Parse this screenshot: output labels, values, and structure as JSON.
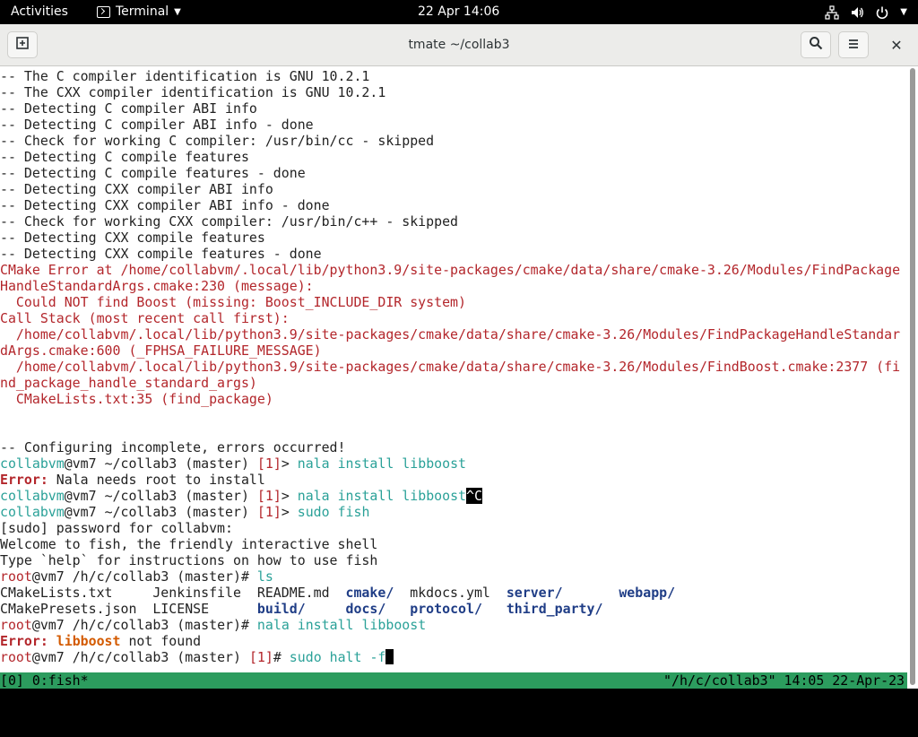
{
  "topbar": {
    "activities": "Activities",
    "app_name": "Terminal",
    "clock": "22 Apr  14:06",
    "tray_icons": [
      "network-icon",
      "volume-icon",
      "power-icon",
      "menu-caret-icon"
    ]
  },
  "window": {
    "title": "tmate ~/collab3",
    "buttons": {
      "new_tab": "new-tab-icon",
      "search": "search-icon",
      "menu": "hamburger-icon",
      "close": "✕"
    }
  },
  "colors": {
    "user": "#2aa198",
    "error": "#b3262b",
    "directory": "#1f3d86",
    "package": "#d35a00",
    "statusbar": "#2c9c5e"
  },
  "terminal": {
    "lines": [
      [
        {
          "c": "dflt",
          "t": "-- The C compiler identification is GNU 10.2.1"
        }
      ],
      [
        {
          "c": "dflt",
          "t": "-- The CXX compiler identification is GNU 10.2.1"
        }
      ],
      [
        {
          "c": "dflt",
          "t": "-- Detecting C compiler ABI info"
        }
      ],
      [
        {
          "c": "dflt",
          "t": "-- Detecting C compiler ABI info - done"
        }
      ],
      [
        {
          "c": "dflt",
          "t": "-- Check for working C compiler: /usr/bin/cc - skipped"
        }
      ],
      [
        {
          "c": "dflt",
          "t": "-- Detecting C compile features"
        }
      ],
      [
        {
          "c": "dflt",
          "t": "-- Detecting C compile features - done"
        }
      ],
      [
        {
          "c": "dflt",
          "t": "-- Detecting CXX compiler ABI info"
        }
      ],
      [
        {
          "c": "dflt",
          "t": "-- Detecting CXX compiler ABI info - done"
        }
      ],
      [
        {
          "c": "dflt",
          "t": "-- Check for working CXX compiler: /usr/bin/c++ - skipped"
        }
      ],
      [
        {
          "c": "dflt",
          "t": "-- Detecting CXX compile features"
        }
      ],
      [
        {
          "c": "dflt",
          "t": "-- Detecting CXX compile features - done"
        }
      ],
      [
        {
          "c": "red",
          "t": "CMake Error at /home/collabvm/.local/lib/python3.9/site-packages/cmake/data/share/cmake-3.26/Modules/FindPackage"
        }
      ],
      [
        {
          "c": "red",
          "t": "HandleStandardArgs.cmake:230 (message):"
        }
      ],
      [
        {
          "c": "red",
          "t": "  Could NOT find Boost (missing: Boost_INCLUDE_DIR system)"
        }
      ],
      [
        {
          "c": "red",
          "t": "Call Stack (most recent call first):"
        }
      ],
      [
        {
          "c": "red",
          "t": "  /home/collabvm/.local/lib/python3.9/site-packages/cmake/data/share/cmake-3.26/Modules/FindPackageHandleStandar"
        }
      ],
      [
        {
          "c": "red",
          "t": "dArgs.cmake:600 (_FPHSA_FAILURE_MESSAGE)"
        }
      ],
      [
        {
          "c": "red",
          "t": "  /home/collabvm/.local/lib/python3.9/site-packages/cmake/data/share/cmake-3.26/Modules/FindBoost.cmake:2377 (fi"
        }
      ],
      [
        {
          "c": "red",
          "t": "nd_package_handle_standard_args)"
        }
      ],
      [
        {
          "c": "red",
          "t": "  CMakeLists.txt:35 (find_package)"
        }
      ],
      [
        {
          "c": "dflt",
          "t": ""
        }
      ],
      [
        {
          "c": "dflt",
          "t": ""
        }
      ],
      [
        {
          "c": "dflt",
          "t": "-- Configuring incomplete, errors occurred!"
        }
      ],
      [
        {
          "c": "usr",
          "t": "collabvm"
        },
        {
          "c": "host",
          "t": "@vm7 "
        },
        {
          "c": "cwd",
          "t": "~/collab3"
        },
        {
          "c": "dflt",
          "t": " (master) "
        },
        {
          "c": "num",
          "t": "[1]"
        },
        {
          "c": "dflt",
          "t": "> "
        },
        {
          "c": "cmd",
          "t": "nala install libboost"
        }
      ],
      [
        {
          "c": "errlab",
          "t": "Error:"
        },
        {
          "c": "dflt",
          "t": " Nala needs root to install"
        }
      ],
      [
        {
          "c": "usr",
          "t": "collabvm"
        },
        {
          "c": "host",
          "t": "@vm7 "
        },
        {
          "c": "cwd",
          "t": "~/collab3"
        },
        {
          "c": "dflt",
          "t": " (master) "
        },
        {
          "c": "num",
          "t": "[1]"
        },
        {
          "c": "dflt",
          "t": "> "
        },
        {
          "c": "cmd",
          "t": "nala install libboost"
        },
        {
          "c": "rev",
          "t": "^C"
        }
      ],
      [
        {
          "c": "usr",
          "t": "collabvm"
        },
        {
          "c": "host",
          "t": "@vm7 "
        },
        {
          "c": "cwd",
          "t": "~/collab3"
        },
        {
          "c": "dflt",
          "t": " (master) "
        },
        {
          "c": "num",
          "t": "[1]"
        },
        {
          "c": "dflt",
          "t": "> "
        },
        {
          "c": "cmd",
          "t": "sudo fish"
        }
      ],
      [
        {
          "c": "dflt",
          "t": "[sudo] password for collabvm:"
        }
      ],
      [
        {
          "c": "dflt",
          "t": "Welcome to fish, the friendly interactive shell"
        }
      ],
      [
        {
          "c": "dflt",
          "t": "Type `help` for instructions on how to use fish"
        }
      ],
      [
        {
          "c": "num",
          "t": "root"
        },
        {
          "c": "host",
          "t": "@vm7 "
        },
        {
          "c": "cwd",
          "t": "/h/c/collab3"
        },
        {
          "c": "dflt",
          "t": " (master)# "
        },
        {
          "c": "cmd",
          "t": "ls"
        }
      ],
      [
        {
          "c": "dflt",
          "t": "CMakeLists.txt     Jenkinsfile  README.md  "
        },
        {
          "c": "dir",
          "t": "cmake/"
        },
        {
          "c": "dflt",
          "t": "  mkdocs.yml  "
        },
        {
          "c": "dir",
          "t": "server/"
        },
        {
          "c": "dflt",
          "t": "       "
        },
        {
          "c": "dir",
          "t": "webapp/"
        }
      ],
      [
        {
          "c": "dflt",
          "t": "CMakePresets.json  LICENSE      "
        },
        {
          "c": "dir",
          "t": "build/"
        },
        {
          "c": "dflt",
          "t": "     "
        },
        {
          "c": "dir",
          "t": "docs/"
        },
        {
          "c": "dflt",
          "t": "   "
        },
        {
          "c": "dir",
          "t": "protocol/"
        },
        {
          "c": "dflt",
          "t": "   "
        },
        {
          "c": "dir",
          "t": "third_party/"
        }
      ],
      [
        {
          "c": "num",
          "t": "root"
        },
        {
          "c": "host",
          "t": "@vm7 "
        },
        {
          "c": "cwd",
          "t": "/h/c/collab3"
        },
        {
          "c": "dflt",
          "t": " (master)# "
        },
        {
          "c": "cmd",
          "t": "nala install libboost"
        }
      ],
      [
        {
          "c": "errlab",
          "t": "Error:"
        },
        {
          "c": "dflt",
          "t": " "
        },
        {
          "c": "pkg",
          "t": "libboost"
        },
        {
          "c": "dflt",
          "t": " not found"
        }
      ],
      [
        {
          "c": "num",
          "t": "root"
        },
        {
          "c": "host",
          "t": "@vm7 "
        },
        {
          "c": "cwd",
          "t": "/h/c/collab3"
        },
        {
          "c": "dflt",
          "t": " (master) "
        },
        {
          "c": "num",
          "t": "[1]"
        },
        {
          "c": "dflt",
          "t": "# "
        },
        {
          "c": "cmd",
          "t": "sudo halt -f"
        },
        {
          "c": "cursor",
          "t": ""
        }
      ]
    ]
  },
  "statusbar": {
    "left": "[0] 0:fish*",
    "right": "\"/h/c/collab3\" 14:05 22-Apr-23"
  }
}
